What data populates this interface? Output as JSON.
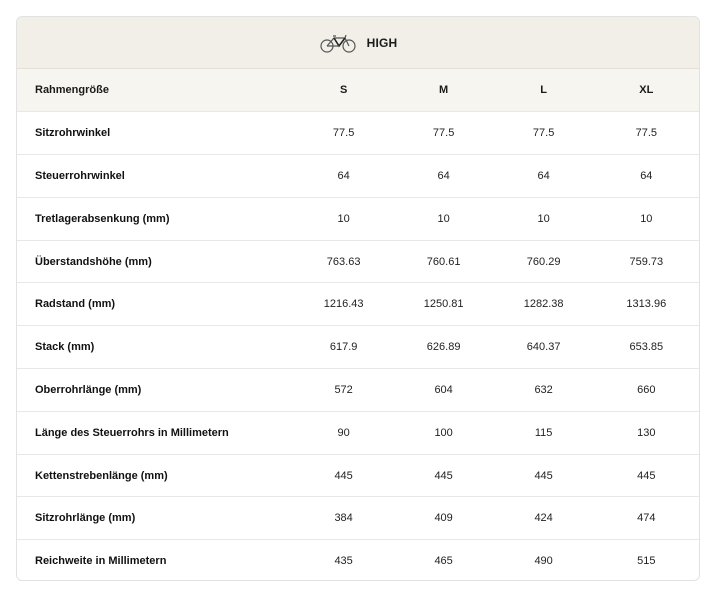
{
  "header": {
    "title": "HIGH",
    "icon": "bicycle-icon"
  },
  "table": {
    "label_header": "Rahmengröße",
    "sizes": [
      "S",
      "M",
      "L",
      "XL"
    ],
    "rows": [
      {
        "label": "Sitzrohrwinkel",
        "values": [
          "77.5",
          "77.5",
          "77.5",
          "77.5"
        ]
      },
      {
        "label": "Steuerrohrwinkel",
        "values": [
          "64",
          "64",
          "64",
          "64"
        ]
      },
      {
        "label": "Tretlagerabsenkung (mm)",
        "values": [
          "10",
          "10",
          "10",
          "10"
        ]
      },
      {
        "label": "Überstandshöhe (mm)",
        "values": [
          "763.63",
          "760.61",
          "760.29",
          "759.73"
        ]
      },
      {
        "label": "Radstand (mm)",
        "values": [
          "1216.43",
          "1250.81",
          "1282.38",
          "1313.96"
        ]
      },
      {
        "label": "Stack (mm)",
        "values": [
          "617.9",
          "626.89",
          "640.37",
          "653.85"
        ]
      },
      {
        "label": "Oberrohrlänge (mm)",
        "values": [
          "572",
          "604",
          "632",
          "660"
        ]
      },
      {
        "label": "Länge des Steuerrohrs in Millimetern",
        "values": [
          "90",
          "100",
          "115",
          "130"
        ]
      },
      {
        "label": "Kettenstrebenlänge (mm)",
        "values": [
          "445",
          "445",
          "445",
          "445"
        ]
      },
      {
        "label": "Sitzrohrlänge (mm)",
        "values": [
          "384",
          "409",
          "424",
          "474"
        ]
      },
      {
        "label": "Reichweite in Millimetern",
        "values": [
          "435",
          "465",
          "490",
          "515"
        ]
      }
    ]
  }
}
